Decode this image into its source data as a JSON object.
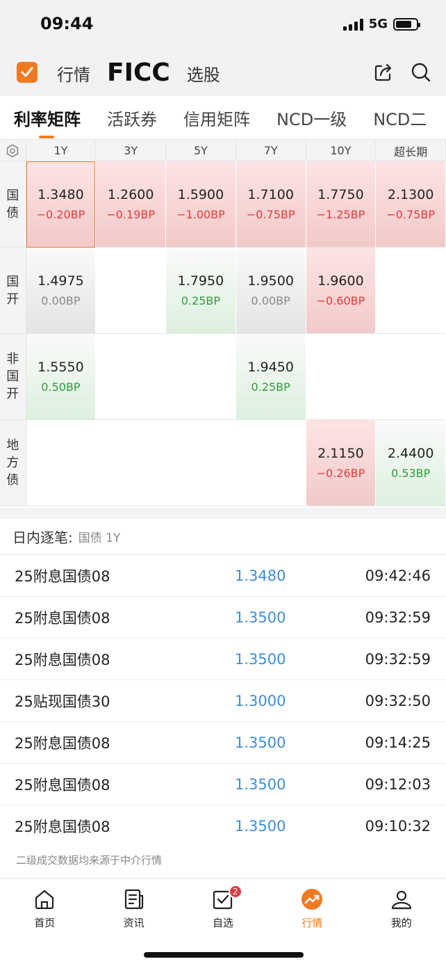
{
  "status_bar": {
    "time": "09:44",
    "network": "5G",
    "battery_level": 0.8
  },
  "header": {
    "logo_icon": "checkbox-logo-icon",
    "nav": [
      "行情",
      "FICC",
      "选股"
    ],
    "active_nav": "FICC",
    "icons": [
      "share-icon",
      "search-icon"
    ]
  },
  "tabs": [
    "利率矩阵",
    "活跃券",
    "信用矩阵",
    "NCD一级",
    "NCD二"
  ],
  "active_tab": "利率矩阵",
  "matrix": {
    "columns": [
      "1Y",
      "3Y",
      "5Y",
      "7Y",
      "10Y",
      "超长期"
    ],
    "rows": [
      {
        "label": "国债",
        "cells": [
          {
            "value": "1.3480",
            "change": "−0.20BP",
            "trend": "down",
            "selected": true
          },
          {
            "value": "1.2600",
            "change": "−0.19BP",
            "trend": "down"
          },
          {
            "value": "1.5900",
            "change": "−1.00BP",
            "trend": "down"
          },
          {
            "value": "1.7100",
            "change": "−0.75BP",
            "trend": "down"
          },
          {
            "value": "1.7750",
            "change": "−1.25BP",
            "trend": "down"
          },
          {
            "value": "2.1300",
            "change": "−0.75BP",
            "trend": "down"
          }
        ]
      },
      {
        "label": "国开",
        "cells": [
          {
            "value": "1.4975",
            "change": "0.00BP",
            "trend": "flat"
          },
          null,
          {
            "value": "1.7950",
            "change": "0.25BP",
            "trend": "up"
          },
          {
            "value": "1.9500",
            "change": "0.00BP",
            "trend": "flat"
          },
          {
            "value": "1.9600",
            "change": "−0.60BP",
            "trend": "down"
          },
          null
        ]
      },
      {
        "label": "非国开",
        "cells": [
          {
            "value": "1.5550",
            "change": "0.50BP",
            "trend": "up"
          },
          null,
          null,
          {
            "value": "1.9450",
            "change": "0.25BP",
            "trend": "up"
          },
          null,
          null
        ]
      },
      {
        "label": "地方债",
        "cells": [
          null,
          null,
          null,
          null,
          {
            "value": "2.1150",
            "change": "−0.26BP",
            "trend": "down"
          },
          {
            "value": "2.4400",
            "change": "0.53BP",
            "trend": "up"
          }
        ]
      }
    ]
  },
  "trades": {
    "title": "日内逐笔:",
    "subtitle": "国债 1Y",
    "rows": [
      {
        "name": "25附息国债08",
        "price": "1.3480",
        "time": "09:42:46"
      },
      {
        "name": "25附息国债08",
        "price": "1.3500",
        "time": "09:32:59"
      },
      {
        "name": "25附息国债08",
        "price": "1.3500",
        "time": "09:32:59"
      },
      {
        "name": "25贴现国债30",
        "price": "1.3000",
        "time": "09:32:50"
      },
      {
        "name": "25附息国债08",
        "price": "1.3500",
        "time": "09:14:25"
      },
      {
        "name": "25附息国债08",
        "price": "1.3500",
        "time": "09:12:03"
      },
      {
        "name": "25附息国债08",
        "price": "1.3500",
        "time": "09:10:32"
      }
    ],
    "footnote": "二级成交数据均来源于中介行情"
  },
  "bottom_nav": [
    {
      "label": "首页",
      "icon": "home-icon"
    },
    {
      "label": "资讯",
      "icon": "news-icon"
    },
    {
      "label": "自选",
      "icon": "watchlist-icon",
      "badge": "2"
    },
    {
      "label": "行情",
      "icon": "market-icon",
      "active": true
    },
    {
      "label": "我的",
      "icon": "profile-icon"
    }
  ],
  "colors": {
    "accent": "#f07a22",
    "down": "#e23b3b",
    "up": "#2f9d3c",
    "price": "#3d8ed9"
  }
}
